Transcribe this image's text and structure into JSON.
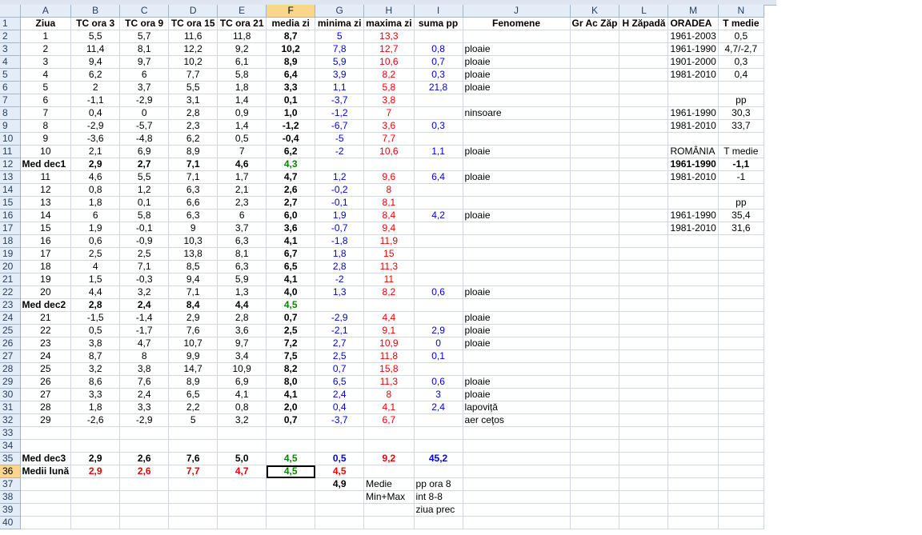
{
  "columns": [
    "A",
    "B",
    "C",
    "D",
    "E",
    "F",
    "G",
    "H",
    "I",
    "J",
    "K",
    "L",
    "M",
    "N"
  ],
  "active_column": "F",
  "active_row": 36,
  "headers": [
    "Ziua",
    "TC ora 3",
    "TC ora 9",
    "TC ora 15",
    "TC ora 21",
    "media zi",
    "minima zi",
    "maxima zi",
    "suma pp",
    "Fenomene",
    "Gr Ac Zăp",
    "H Zăpadă",
    "ORADEA",
    "T medie"
  ],
  "rows": [
    [
      "1",
      "5,5",
      "5,7",
      "11,6",
      "11,8",
      "8,7",
      "5",
      "13,3",
      "",
      "",
      "",
      "",
      "1961-2003",
      "0,5"
    ],
    [
      "2",
      "11,4",
      "8,1",
      "12,2",
      "9,2",
      "10,2",
      "7,8",
      "12,7",
      "0,8",
      "ploaie",
      "",
      "",
      "1961-1990",
      "4,7/-2,7"
    ],
    [
      "3",
      "9,4",
      "9,7",
      "10,2",
      "6,1",
      "8,9",
      "5,9",
      "10,6",
      "0,7",
      "ploaie",
      "",
      "",
      "1901-2000",
      "0,3"
    ],
    [
      "4",
      "6,2",
      "6",
      "7,7",
      "5,8",
      "6,4",
      "3,9",
      "8,2",
      "0,3",
      "ploaie",
      "",
      "",
      "1981-2010",
      "0,4"
    ],
    [
      "5",
      "2",
      "3,7",
      "5,5",
      "1,8",
      "3,3",
      "1,1",
      "5,8",
      "21,8",
      "ploaie",
      "",
      "",
      "",
      ""
    ],
    [
      "6",
      "-1,1",
      "-2,9",
      "3,1",
      "1,4",
      "0,1",
      "-3,7",
      "3,8",
      "",
      "",
      "",
      "",
      "",
      "pp"
    ],
    [
      "7",
      "0,4",
      "0",
      "2,8",
      "0,9",
      "1,0",
      "-1,2",
      "7",
      "",
      "ninsoare",
      "",
      "",
      "1961-1990",
      "30,3"
    ],
    [
      "8",
      "-2,9",
      "-5,7",
      "2,3",
      "1,4",
      "-1,2",
      "-6,7",
      "3,6",
      "0,3",
      "",
      "",
      "",
      "1981-2010",
      "33,7"
    ],
    [
      "9",
      "-3,6",
      "-4,8",
      "6,2",
      "0,5",
      "-0,4",
      "-5",
      "7,7",
      "",
      "",
      "",
      "",
      "",
      ""
    ],
    [
      "10",
      "2,1",
      "6,9",
      "8,9",
      "7",
      "6,2",
      "-2",
      "10,6",
      "1,1",
      "ploaie",
      "",
      "",
      "ROMÂNIA",
      "T medie"
    ],
    [
      "Med dec1",
      "2,9",
      "2,7",
      "7,1",
      "4,6",
      "4,3",
      "",
      "",
      "",
      "",
      "",
      "",
      "1961-1990",
      "-1,1"
    ],
    [
      "11",
      "4,6",
      "5,5",
      "7,1",
      "1,7",
      "4,7",
      "1,2",
      "9,6",
      "6,4",
      "ploaie",
      "",
      "",
      "1981-2010",
      "-1"
    ],
    [
      "12",
      "0,8",
      "1,2",
      "6,3",
      "2,1",
      "2,6",
      "-0,2",
      "8",
      "",
      "",
      "",
      "",
      "",
      ""
    ],
    [
      "13",
      "1,8",
      "0,1",
      "6,6",
      "2,3",
      "2,7",
      "-0,1",
      "8,1",
      "",
      "",
      "",
      "",
      "",
      "pp"
    ],
    [
      "14",
      "6",
      "5,8",
      "6,3",
      "6",
      "6,0",
      "1,9",
      "8,4",
      "4,2",
      "ploaie",
      "",
      "",
      "1961-1990",
      "35,4"
    ],
    [
      "15",
      "1,9",
      "-0,1",
      "9",
      "3,7",
      "3,6",
      "-0,7",
      "9,4",
      "",
      "",
      "",
      "",
      "1981-2010",
      "31,6"
    ],
    [
      "16",
      "0,6",
      "-0,9",
      "10,3",
      "6,3",
      "4,1",
      "-1,8",
      "11,9",
      "",
      "",
      "",
      "",
      "",
      ""
    ],
    [
      "17",
      "2,5",
      "2,5",
      "13,8",
      "8,1",
      "6,7",
      "1,8",
      "15",
      "",
      "",
      "",
      "",
      "",
      ""
    ],
    [
      "18",
      "4",
      "7,1",
      "8,5",
      "6,3",
      "6,5",
      "2,8",
      "11,3",
      "",
      "",
      "",
      "",
      "",
      ""
    ],
    [
      "19",
      "1,5",
      "-0,3",
      "9,4",
      "5,9",
      "4,1",
      "-2",
      "11",
      "",
      "",
      "",
      "",
      "",
      ""
    ],
    [
      "20",
      "4,4",
      "3,2",
      "7,1",
      "1,3",
      "4,0",
      "1,3",
      "8,2",
      "0,6",
      "ploaie",
      "",
      "",
      "",
      ""
    ],
    [
      "Med dec2",
      "2,8",
      "2,4",
      "8,4",
      "4,4",
      "4,5",
      "",
      "",
      "",
      "",
      "",
      "",
      "",
      ""
    ],
    [
      "21",
      "-1,5",
      "-1,4",
      "2,9",
      "2,8",
      "0,7",
      "-2,9",
      "4,4",
      "",
      "ploaie",
      "",
      "",
      "",
      ""
    ],
    [
      "22",
      "0,5",
      "-1,7",
      "7,6",
      "3,6",
      "2,5",
      "-2,1",
      "9,1",
      "2,9",
      "ploaie",
      "",
      "",
      "",
      ""
    ],
    [
      "23",
      "3,8",
      "4,7",
      "10,7",
      "9,7",
      "7,2",
      "2,7",
      "10,9",
      "0",
      "ploaie",
      "",
      "",
      "",
      ""
    ],
    [
      "24",
      "8,7",
      "8",
      "9,9",
      "3,4",
      "7,5",
      "2,5",
      "11,8",
      "0,1",
      "",
      "",
      "",
      "",
      ""
    ],
    [
      "25",
      "3,2",
      "3,8",
      "14,7",
      "10,9",
      "8,2",
      "0,7",
      "15,8",
      "",
      "",
      "",
      "",
      "",
      ""
    ],
    [
      "26",
      "8,6",
      "7,6",
      "8,9",
      "6,9",
      "8,0",
      "6,5",
      "11,3",
      "0,6",
      "ploaie",
      "",
      "",
      "",
      ""
    ],
    [
      "27",
      "3,3",
      "2,4",
      "6,5",
      "4,1",
      "4,1",
      "2,4",
      "8",
      "3",
      "ploaie",
      "",
      "",
      "",
      ""
    ],
    [
      "28",
      "1,8",
      "3,3",
      "2,2",
      "0,8",
      "2,0",
      "0,4",
      "4,1",
      "2,4",
      "lapoviță",
      "",
      "",
      "",
      ""
    ],
    [
      "29",
      "-2,6",
      "-2,9",
      "5",
      "3,2",
      "0,7",
      "-3,7",
      "6,7",
      "",
      "aer ceţos",
      "",
      "",
      "",
      ""
    ],
    [
      "",
      "",
      "",
      "",
      "",
      "",
      "",
      "",
      "",
      "",
      "",
      "",
      "",
      ""
    ],
    [
      "",
      "",
      "",
      "",
      "",
      "",
      "",
      "",
      "",
      "",
      "",
      "",
      "",
      ""
    ],
    [
      "Med dec3",
      "2,9",
      "2,6",
      "7,6",
      "5,0",
      "4,5",
      "0,5",
      "9,2",
      "45,2",
      "",
      "",
      "",
      "",
      ""
    ],
    [
      "Medii lună",
      "2,9",
      "2,6",
      "7,7",
      "4,7",
      "4,5",
      "4,5",
      "",
      "",
      "",
      "",
      "",
      "",
      ""
    ],
    [
      "",
      "",
      "",
      "",
      "",
      "",
      "4,9",
      "Medie",
      "pp ora 8",
      "",
      "",
      "",
      "",
      ""
    ],
    [
      "",
      "",
      "",
      "",
      "",
      "",
      "",
      "Min+Max",
      "int 8-8",
      "",
      "",
      "",
      "",
      ""
    ],
    [
      "",
      "",
      "",
      "",
      "",
      "",
      "",
      "",
      "ziua prec",
      "",
      "",
      "",
      "",
      ""
    ],
    [
      "",
      "",
      "",
      "",
      "",
      "",
      "",
      "",
      "",
      "",
      "",
      "",
      "",
      ""
    ]
  ]
}
